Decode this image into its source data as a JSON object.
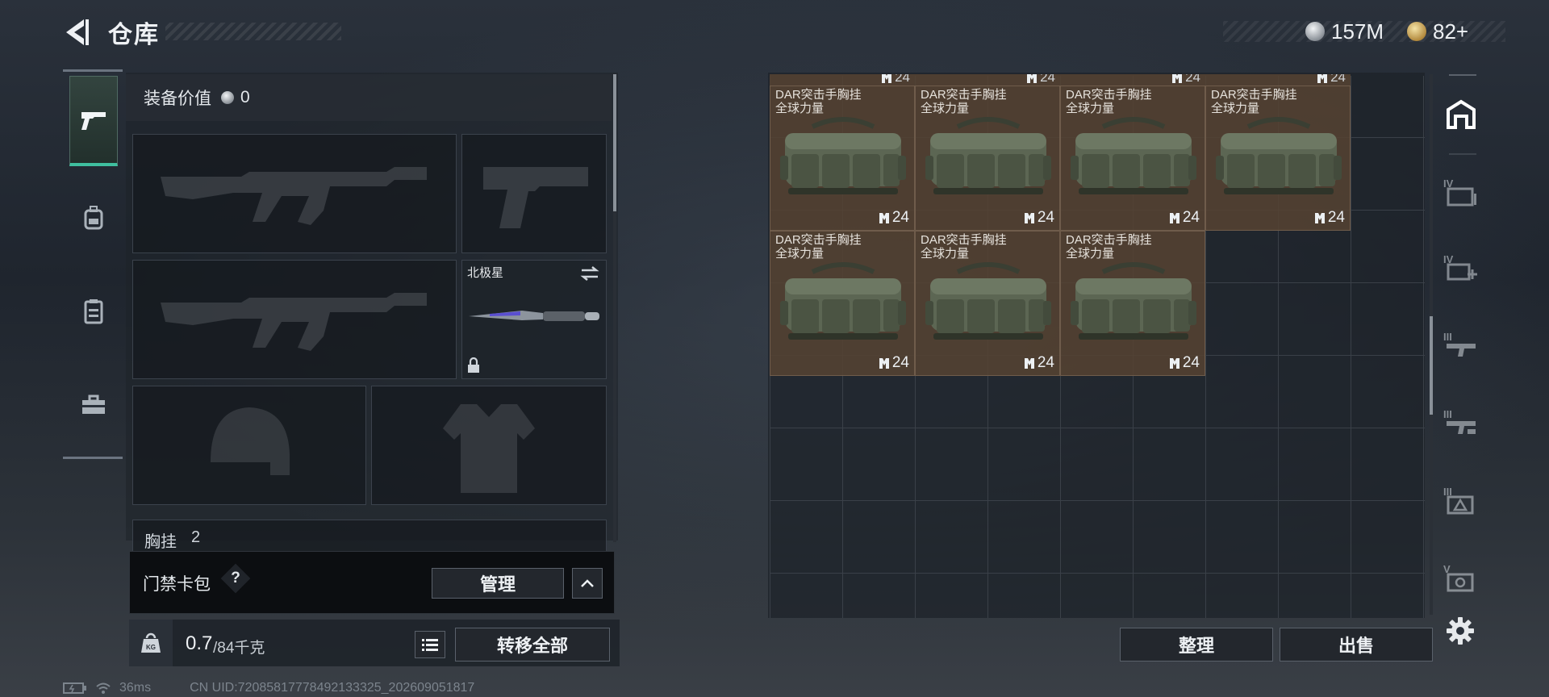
{
  "header": {
    "title": "仓库",
    "currency": {
      "silver_label": "157M",
      "gold_label": "82+"
    }
  },
  "equipment": {
    "value_label": "装备价值",
    "value": "0",
    "melee_name": "北极星",
    "chest_section_label": "胸挂",
    "chest_count": "2"
  },
  "keycard": {
    "label": "门禁卡包",
    "help": "?",
    "manage_label": "管理"
  },
  "weight": {
    "current": "0.7",
    "max_label": "/84千克",
    "transfer_all_label": "转移全部"
  },
  "inventory": {
    "top_counts": [
      "24",
      "24",
      "24",
      "24"
    ],
    "items": [
      {
        "name": "DAR突击手胸挂",
        "sub": "全球力量",
        "count": "24"
      },
      {
        "name": "DAR突击手胸挂",
        "sub": "全球力量",
        "count": "24"
      },
      {
        "name": "DAR突击手胸挂",
        "sub": "全球力量",
        "count": "24"
      },
      {
        "name": "DAR突击手胸挂",
        "sub": "全球力量",
        "count": "24"
      },
      {
        "name": "DAR突击手胸挂",
        "sub": "全球力量",
        "count": "24"
      },
      {
        "name": "DAR突击手胸挂",
        "sub": "全球力量",
        "count": "24"
      },
      {
        "name": "DAR突击手胸挂",
        "sub": "全球力量",
        "count": "24"
      }
    ],
    "sort_label": "整理",
    "sell_label": "出售"
  },
  "tabs": {
    "iv": "IV",
    "iii": "III",
    "v": "V"
  },
  "status": {
    "ping": "36ms",
    "uid": "CN UID:72085817778492133325_202609051817"
  },
  "colors": {
    "accent_green": "#3fbf9f",
    "item_bg": "#54423a",
    "panel_bg": "#1e2228"
  },
  "icons": [
    "back-arrow-icon",
    "pistol-icon",
    "backpack-icon",
    "vest-icon",
    "toolbox-icon",
    "lock-icon",
    "swap-icon",
    "weight-icon",
    "list-icon",
    "chevron-up-icon",
    "warehouse-icon",
    "settings-icon",
    "battery-icon",
    "wifi-icon"
  ]
}
